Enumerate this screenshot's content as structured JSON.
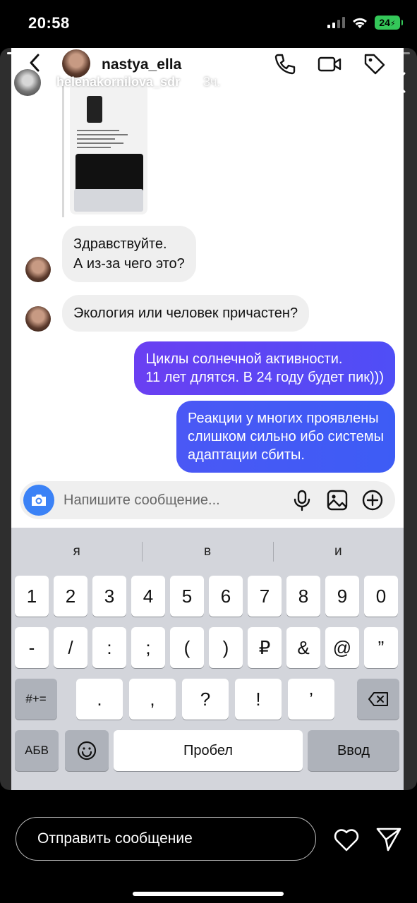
{
  "status_bar": {
    "time": "20:58",
    "battery": "24"
  },
  "story": {
    "progress": 0.97,
    "username": "helenakornilova_sdr",
    "time_ago": "3ч.",
    "reply_placeholder": "Отправить сообщение"
  },
  "chat": {
    "username": "nastya_ella",
    "messages": [
      {
        "from": "them",
        "lines": [
          "Здравствуйте.",
          "А из-за чего это?"
        ]
      },
      {
        "from": "them",
        "lines": [
          "Экология или человек причастен?"
        ]
      },
      {
        "from": "me",
        "lines": [
          "Циклы солнечной активности.",
          "11 лет длятся. В 24 году будет пик)))"
        ]
      },
      {
        "from": "me",
        "lines": [
          "Реакции у многих проявлены",
          "слишком сильно ибо системы",
          "адаптации сбиты."
        ]
      }
    ],
    "composer_placeholder": "Напишите сообщение..."
  },
  "keyboard": {
    "suggestions": [
      "я",
      "в",
      "и"
    ],
    "row1": [
      "1",
      "2",
      "3",
      "4",
      "5",
      "6",
      "7",
      "8",
      "9",
      "0"
    ],
    "row2": [
      "-",
      "/",
      ":",
      ";",
      "(",
      ")",
      "₽",
      "&",
      "@",
      "”"
    ],
    "row3": [
      ".",
      ",",
      "?",
      "!",
      "’"
    ],
    "shift_label": "#+=",
    "abc_label": "АБВ",
    "space_label": "Пробел",
    "return_label": "Ввод"
  }
}
